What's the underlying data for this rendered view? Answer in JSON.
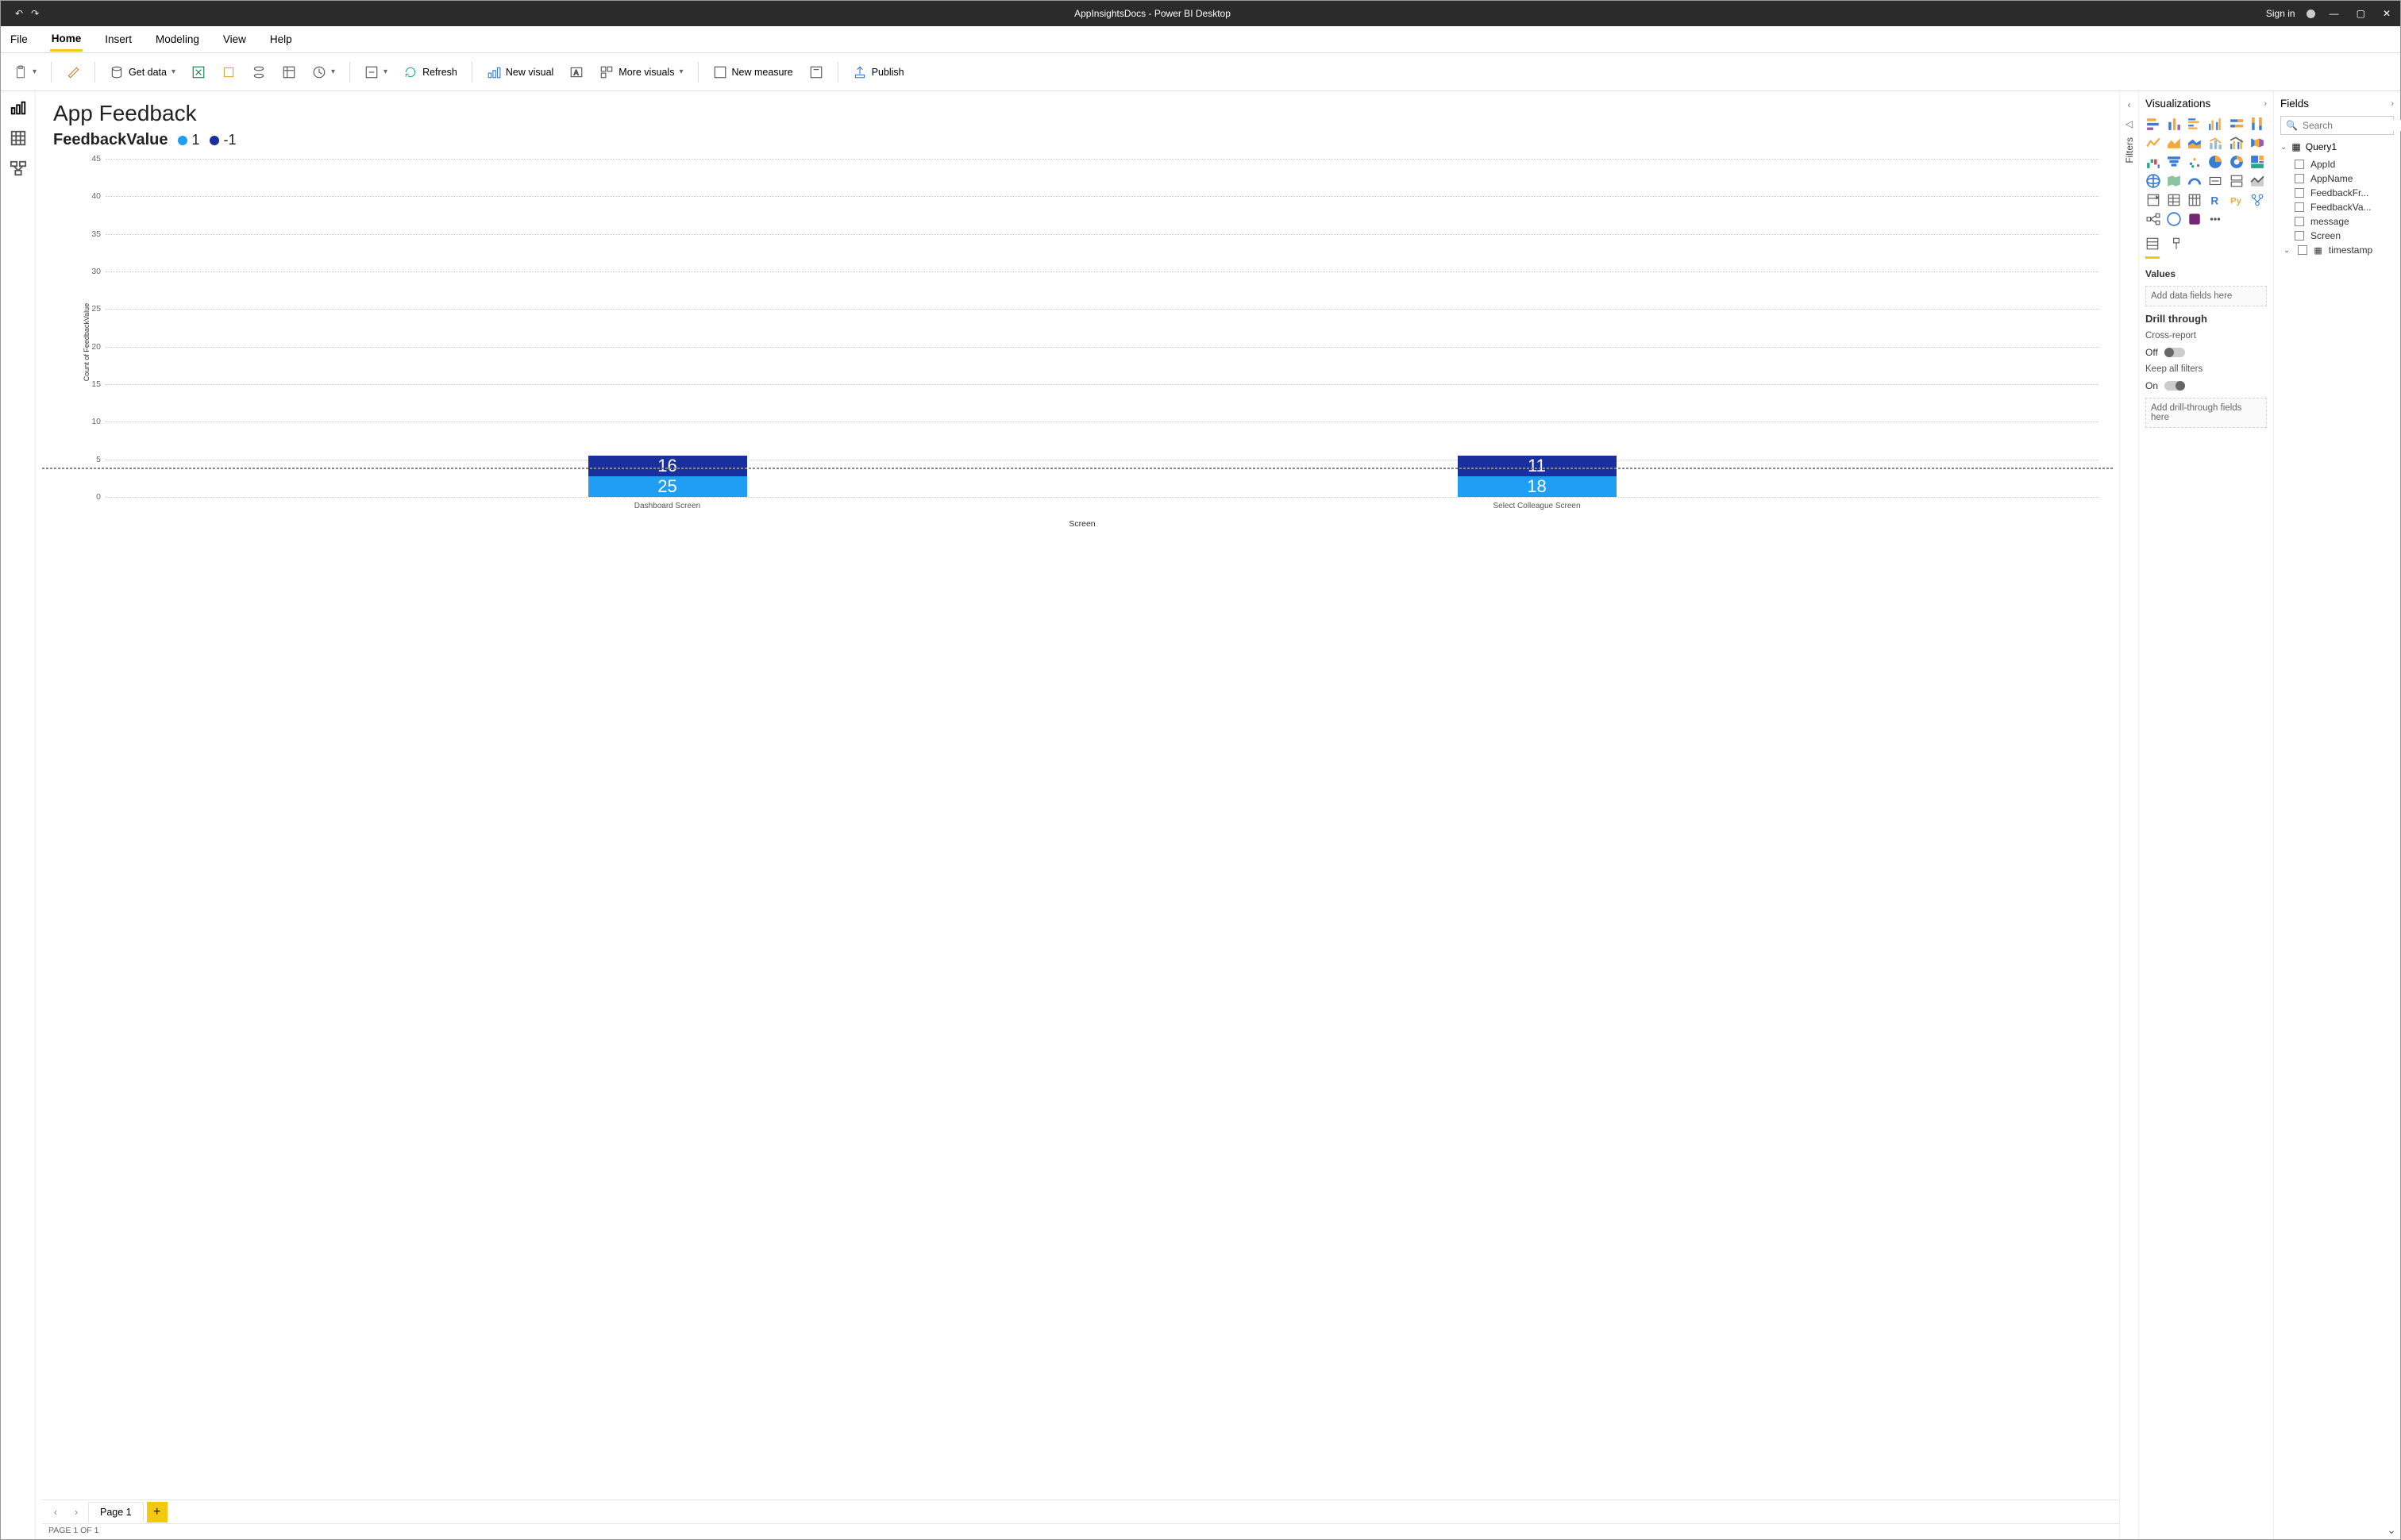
{
  "titlebar": {
    "title": "AppInsightsDocs - Power BI Desktop",
    "signin": "Sign in"
  },
  "menubar": [
    "File",
    "Home",
    "Insert",
    "Modeling",
    "View",
    "Help"
  ],
  "menu_active": "Home",
  "ribbon": {
    "get_data": "Get data",
    "refresh": "Refresh",
    "new_visual": "New visual",
    "more_visuals": "More visuals",
    "new_measure": "New measure",
    "publish": "Publish"
  },
  "report": {
    "title": "App Feedback",
    "legend_title": "FeedbackValue",
    "xlabel": "Screen",
    "ylabel": "Count of FeedbackValue"
  },
  "chart_data": {
    "type": "bar",
    "stacked": true,
    "title": "App Feedback",
    "xlabel": "Screen",
    "ylabel": "Count of FeedbackValue",
    "ylim": [
      0,
      45
    ],
    "yticks": [
      0,
      5,
      10,
      15,
      20,
      25,
      30,
      35,
      40,
      45
    ],
    "categories": [
      "Dashboard Screen",
      "Select Colleague Screen"
    ],
    "series": [
      {
        "name": "1",
        "color": "#1f9ef3",
        "values": [
          25,
          18
        ]
      },
      {
        "name": "-1",
        "color": "#1a2f9e",
        "values": [
          16,
          11
        ]
      }
    ]
  },
  "filters_label": "Filters",
  "viz": {
    "header": "Visualizations",
    "values_label": "Values",
    "values_placeholder": "Add data fields here",
    "drill_header": "Drill through",
    "cross_report": "Cross-report",
    "cross_state": "Off",
    "keep_filters": "Keep all filters",
    "keep_state": "On",
    "drill_placeholder": "Add drill-through fields here"
  },
  "fields": {
    "header": "Fields",
    "search_placeholder": "Search",
    "table": "Query1",
    "items": [
      "AppId",
      "AppName",
      "FeedbackFr...",
      "FeedbackVa...",
      "message",
      "Screen",
      "timestamp"
    ]
  },
  "pagebar": {
    "page": "Page 1"
  },
  "status": "PAGE 1 OF 1"
}
